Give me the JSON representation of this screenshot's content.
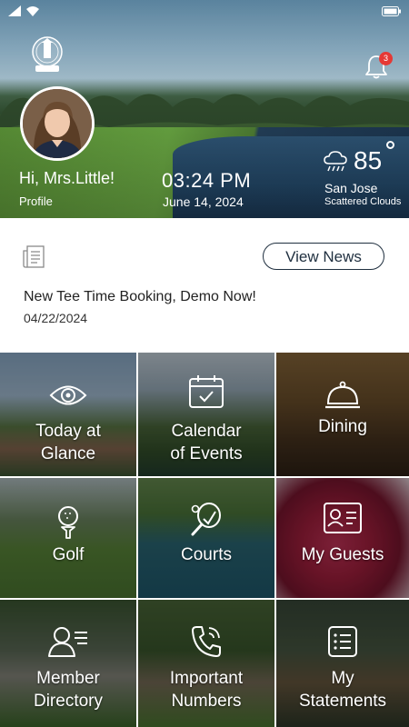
{
  "statusbar": {
    "signal_icon": "signal-icon",
    "wifi_icon": "wifi-icon",
    "battery_icon": "battery-icon"
  },
  "hero": {
    "logo_icon": "club-logo-icon",
    "notification_icon": "bell-icon",
    "notification_count": "3",
    "greeting": "Hi, Mrs.Little!",
    "profile_label": "Profile",
    "time": "03:24 PM",
    "date": "June 14, 2024",
    "weather": {
      "icon": "rain-cloud-icon",
      "temperature": "85",
      "city": "San Jose",
      "condition": "Scattered Clouds"
    }
  },
  "news": {
    "icon": "newspaper-icon",
    "view_button": "View News",
    "headline": "New Tee Time Booking, Demo Now!",
    "date": "04/22/2024"
  },
  "tiles": [
    {
      "label_1": "Today at",
      "label_2": "Glance",
      "icon": "eye-icon"
    },
    {
      "label_1": "Calendar",
      "label_2": "of Events",
      "icon": "calendar-icon"
    },
    {
      "label_1": "Dining",
      "icon": "cloche-icon"
    },
    {
      "label_1": "Golf",
      "icon": "golf-ball-tee-icon"
    },
    {
      "label_1": "Courts",
      "icon": "tennis-racket-icon"
    },
    {
      "label_1": "My Guests",
      "icon": "id-card-icon"
    },
    {
      "label_1": "Member",
      "label_2": "Directory",
      "icon": "members-icon"
    },
    {
      "label_1": "Important",
      "label_2": "Numbers",
      "icon": "phone-icon"
    },
    {
      "label_1": "My",
      "label_2": "Statements",
      "icon": "statement-list-icon"
    }
  ],
  "colors": {
    "badge": "#e53935",
    "button_border": "#1f2f3f"
  }
}
